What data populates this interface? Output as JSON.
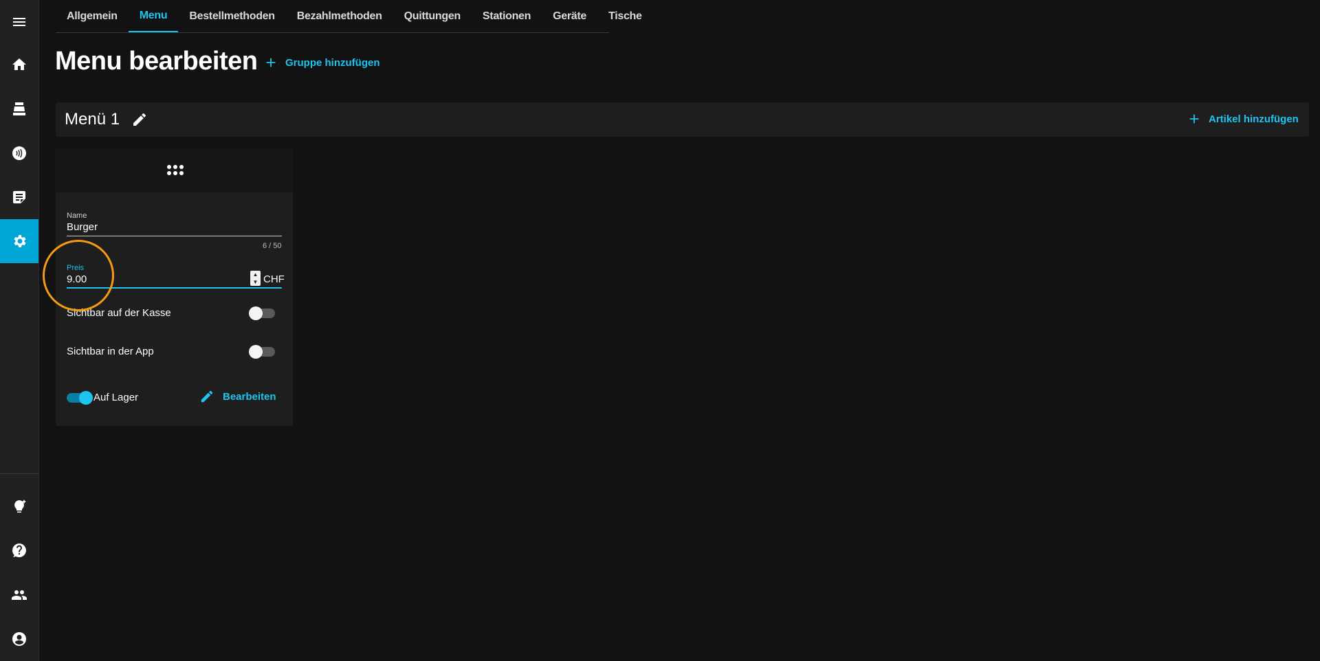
{
  "tabs": [
    "Allgemein",
    "Menu",
    "Bestellmethoden",
    "Bezahlmethoden",
    "Quittungen",
    "Stationen",
    "Geräte",
    "Tische"
  ],
  "active_tab": "Menu",
  "page": {
    "title": "Menu bearbeiten",
    "add_group_label": "Gruppe hinzufügen"
  },
  "menu": {
    "name": "Menü 1",
    "add_article_label": "Artikel hinzufügen"
  },
  "item": {
    "name_label": "Name",
    "name_value": "Burger",
    "name_counter": "6 / 50",
    "price_label": "Preis",
    "price_value": "9.00",
    "currency": "CHF",
    "visible_pos_label": "Sichtbar auf der Kasse",
    "visible_pos": false,
    "visible_app_label": "Sichtbar in der App",
    "visible_app": false,
    "in_stock_label": "Auf Lager",
    "in_stock": true,
    "edit_label": "Bearbeiten"
  },
  "colors": {
    "accent": "#1ec4ef",
    "highlight": "#f39c12",
    "background": "#121212"
  },
  "sidebar_icons": [
    "menu-icon",
    "home-icon",
    "cash-register-icon",
    "contactless-icon",
    "orders-icon",
    "settings-icon",
    "lightbulb-icon",
    "help-icon",
    "users-icon",
    "account-icon"
  ]
}
